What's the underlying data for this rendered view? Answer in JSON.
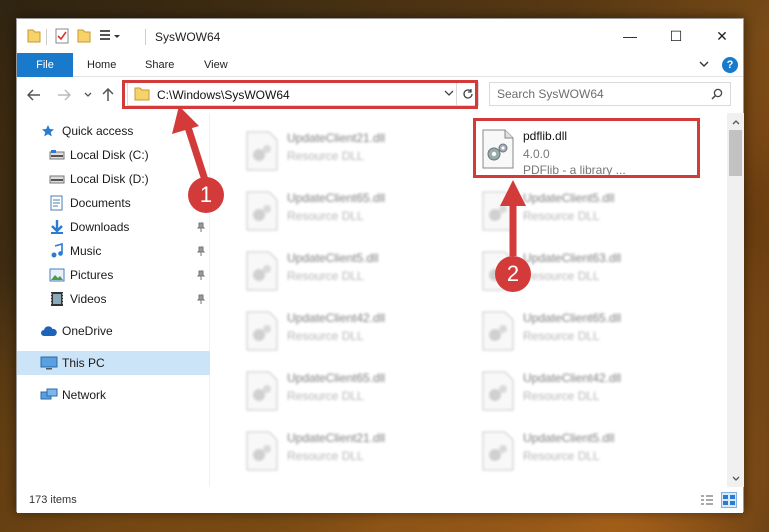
{
  "window": {
    "title": "SysWOW64",
    "controls": [
      "—",
      "☐",
      "✕"
    ]
  },
  "ribbon": {
    "file": "File",
    "tabs": [
      "Home",
      "Share",
      "View"
    ],
    "help": "?"
  },
  "address": {
    "path": "C:\\Windows\\SysWOW64"
  },
  "search": {
    "placeholder": "Search SysWOW64"
  },
  "sidebar": {
    "items": [
      {
        "label": "Quick access",
        "icon": "star-icon"
      },
      {
        "label": "Local Disk (C:)",
        "icon": "drive-icon"
      },
      {
        "label": "Local Disk (D:)",
        "icon": "drive-icon"
      },
      {
        "label": "Documents",
        "icon": "documents-icon"
      },
      {
        "label": "Downloads",
        "icon": "download-icon"
      },
      {
        "label": "Music",
        "icon": "music-icon"
      },
      {
        "label": "Pictures",
        "icon": "pictures-icon"
      },
      {
        "label": "Videos",
        "icon": "videos-icon"
      },
      {
        "label": "OneDrive",
        "icon": "cloud-icon"
      },
      {
        "label": "This PC",
        "icon": "computer-icon"
      },
      {
        "label": "Network",
        "icon": "network-icon"
      }
    ]
  },
  "files": {
    "left": [
      {
        "name": "UpdateClient21.dll",
        "type": "Resource DLL"
      },
      {
        "name": "UpdateClient65.dll",
        "type": "Resource DLL"
      },
      {
        "name": "UpdateClient5.dll",
        "type": "Resource DLL"
      },
      {
        "name": "UpdateClient42.dll",
        "type": "Resource DLL"
      },
      {
        "name": "UpdateClient65.dll",
        "type": "Resource DLL"
      },
      {
        "name": "UpdateClient21.dll",
        "type": "Resource DLL"
      }
    ],
    "highlight": {
      "name": "pdflib.dll",
      "version": "4.0.0",
      "description": "PDFlib - a library ..."
    },
    "right": [
      {
        "name": "UpdateClient5.dll",
        "type": "Resource DLL"
      },
      {
        "name": "UpdateClient63.dll",
        "type": "Resource DLL"
      },
      {
        "name": "UpdateClient65.dll",
        "type": "Resource DLL"
      },
      {
        "name": "UpdateClient42.dll",
        "type": "Resource DLL"
      },
      {
        "name": "UpdateClient5.dll",
        "type": "Resource DLL"
      }
    ]
  },
  "status": {
    "count": "173 items"
  },
  "annotations": {
    "step1": "1",
    "step2": "2",
    "color": "#d33a3a"
  },
  "colors": {
    "accent": "#1979ca",
    "selected": "#cce4f7"
  }
}
